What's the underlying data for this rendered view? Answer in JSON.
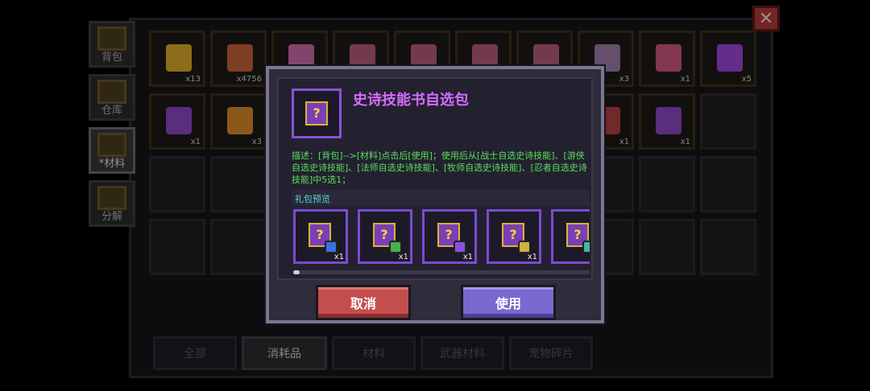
{
  "close_label": "✕",
  "side_tabs": [
    {
      "label": "背包",
      "icon": "backpack-icon"
    },
    {
      "label": "仓库",
      "icon": "chest-icon"
    },
    {
      "label": "*材料",
      "icon": "material-icon"
    },
    {
      "label": "分解",
      "icon": "anvil-icon"
    }
  ],
  "grid_items": [
    {
      "qty": "x13",
      "color": "#d9a62b",
      "icon": "coin-icon"
    },
    {
      "qty": "x4756",
      "color": "#c0603a",
      "icon": "leather-icon"
    },
    {
      "qty": "",
      "color": "#c66aa6",
      "icon": "cloth-icon"
    },
    {
      "qty": "",
      "color": "#b15a7a",
      "icon": "chest-icon"
    },
    {
      "qty": "",
      "color": "#b15a7a",
      "icon": "chest-icon"
    },
    {
      "qty": "",
      "color": "#b15a7a",
      "icon": "chest-icon"
    },
    {
      "qty": "",
      "color": "#b15a7a",
      "icon": "chest-icon"
    },
    {
      "qty": "x3",
      "color": "#9a7aa6",
      "icon": "chest-icon"
    },
    {
      "qty": "x1",
      "color": "#c9557c",
      "icon": "chest-icon"
    },
    {
      "qty": "x5",
      "color": "#9b44d4",
      "icon": "potion-icon"
    },
    {
      "qty": "x1",
      "color": "#8a46c0",
      "icon": "skill-book-icon"
    },
    {
      "qty": "x3",
      "color": "#d9862b",
      "icon": "skull-icon"
    },
    {
      "qty": "",
      "color": "",
      "icon": ""
    },
    {
      "qty": "",
      "color": "",
      "icon": ""
    },
    {
      "qty": "",
      "color": "",
      "icon": ""
    },
    {
      "qty": "",
      "color": "",
      "icon": ""
    },
    {
      "qty": "",
      "color": "",
      "icon": ""
    },
    {
      "qty": "x1",
      "color": "#b04040",
      "icon": "ring-icon"
    },
    {
      "qty": "x1",
      "color": "#8a46c0",
      "icon": "chest-icon"
    },
    {
      "qty": "",
      "color": "",
      "icon": ""
    }
  ],
  "category_tabs": [
    "全部",
    "消耗品",
    "材料",
    "武器材料",
    "宠物碎片"
  ],
  "dialog": {
    "title": "史诗技能书自选包",
    "description": "描述：[背包]-->[材料]点击后[使用]；使用后从[战士自选史诗技能]、[游侠自选史诗技能]、[法师自选史诗技能]、[牧师自选史诗技能]、[忍者自选史诗技能]中5选1；",
    "preview_label": "礼包预览",
    "preview_items": [
      {
        "qty": "x1",
        "sub_color": "#3b6fe0",
        "icon": "warrior-skill-book-icon"
      },
      {
        "qty": "x1",
        "sub_color": "#46b04a",
        "icon": "ranger-skill-book-icon"
      },
      {
        "qty": "x1",
        "sub_color": "#8a50e0",
        "icon": "mage-skill-book-icon"
      },
      {
        "qty": "x1",
        "sub_color": "#d0b040",
        "icon": "priest-skill-book-icon"
      },
      {
        "qty": "",
        "sub_color": "#3fb8a0",
        "icon": "ninja-skill-book-icon"
      }
    ],
    "cancel_label": "取消",
    "use_label": "使用"
  },
  "colors": {
    "title_purple": "#d66cff",
    "desc_green": "#58e05a",
    "cancel_red": "#c44e4e",
    "use_purple": "#7a68d0"
  }
}
